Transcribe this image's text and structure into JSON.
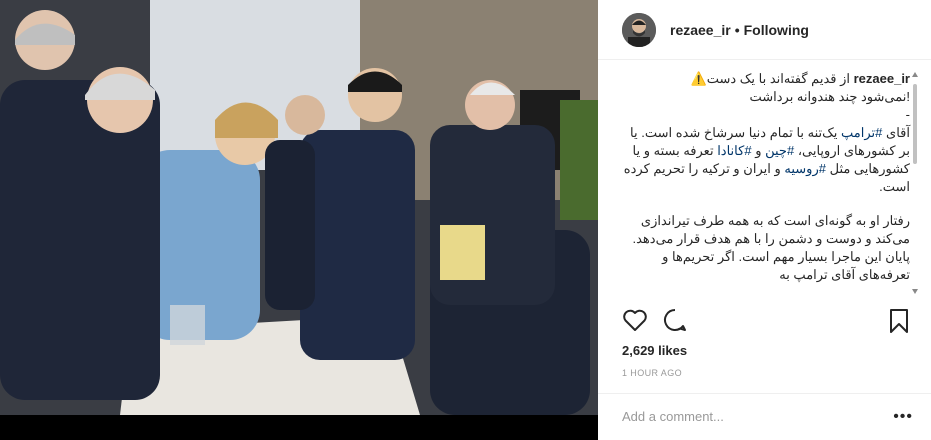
{
  "post": {
    "username": "rezaee_ir",
    "follow_dot": "•",
    "follow_status": "Following"
  },
  "caption": {
    "author": "rezaee_ir",
    "line1": "از قدیم گفته‌اند با یک دست",
    "line1b": "!نمی‌شود چند هندوانه برداشت",
    "dash": "-",
    "para2_a": "آقای",
    "tag_trump": "#ترامپ",
    "para2_b": "یک‌تنه با تمام دنیا سرشاخ شده است. یا بر کشورهای اروپایی،",
    "tag_china": "#چین",
    "para2_c": "و",
    "tag_canada": "#کانادا",
    "para2_d": "تعرفه بسته و یا کشورهایی مثل",
    "tag_russia": "#روسیه",
    "para2_e": "و ایران و ترکیه را تحریم کرده است.",
    "para3": "رفتار او به گونه‌ای است که به همه طرف تیراندازی می‌کند و دوست و دشمن را با هم هدف قرار می‌دهد. پایان این ماجرا بسیار مهم است. اگر تحریم‌ها و تعرفه‌های آقای ترامپ به"
  },
  "stats": {
    "likes": "2,629 likes",
    "time": "1 HOUR AGO"
  },
  "comment": {
    "placeholder": "Add a comment...",
    "more": "•••"
  }
}
